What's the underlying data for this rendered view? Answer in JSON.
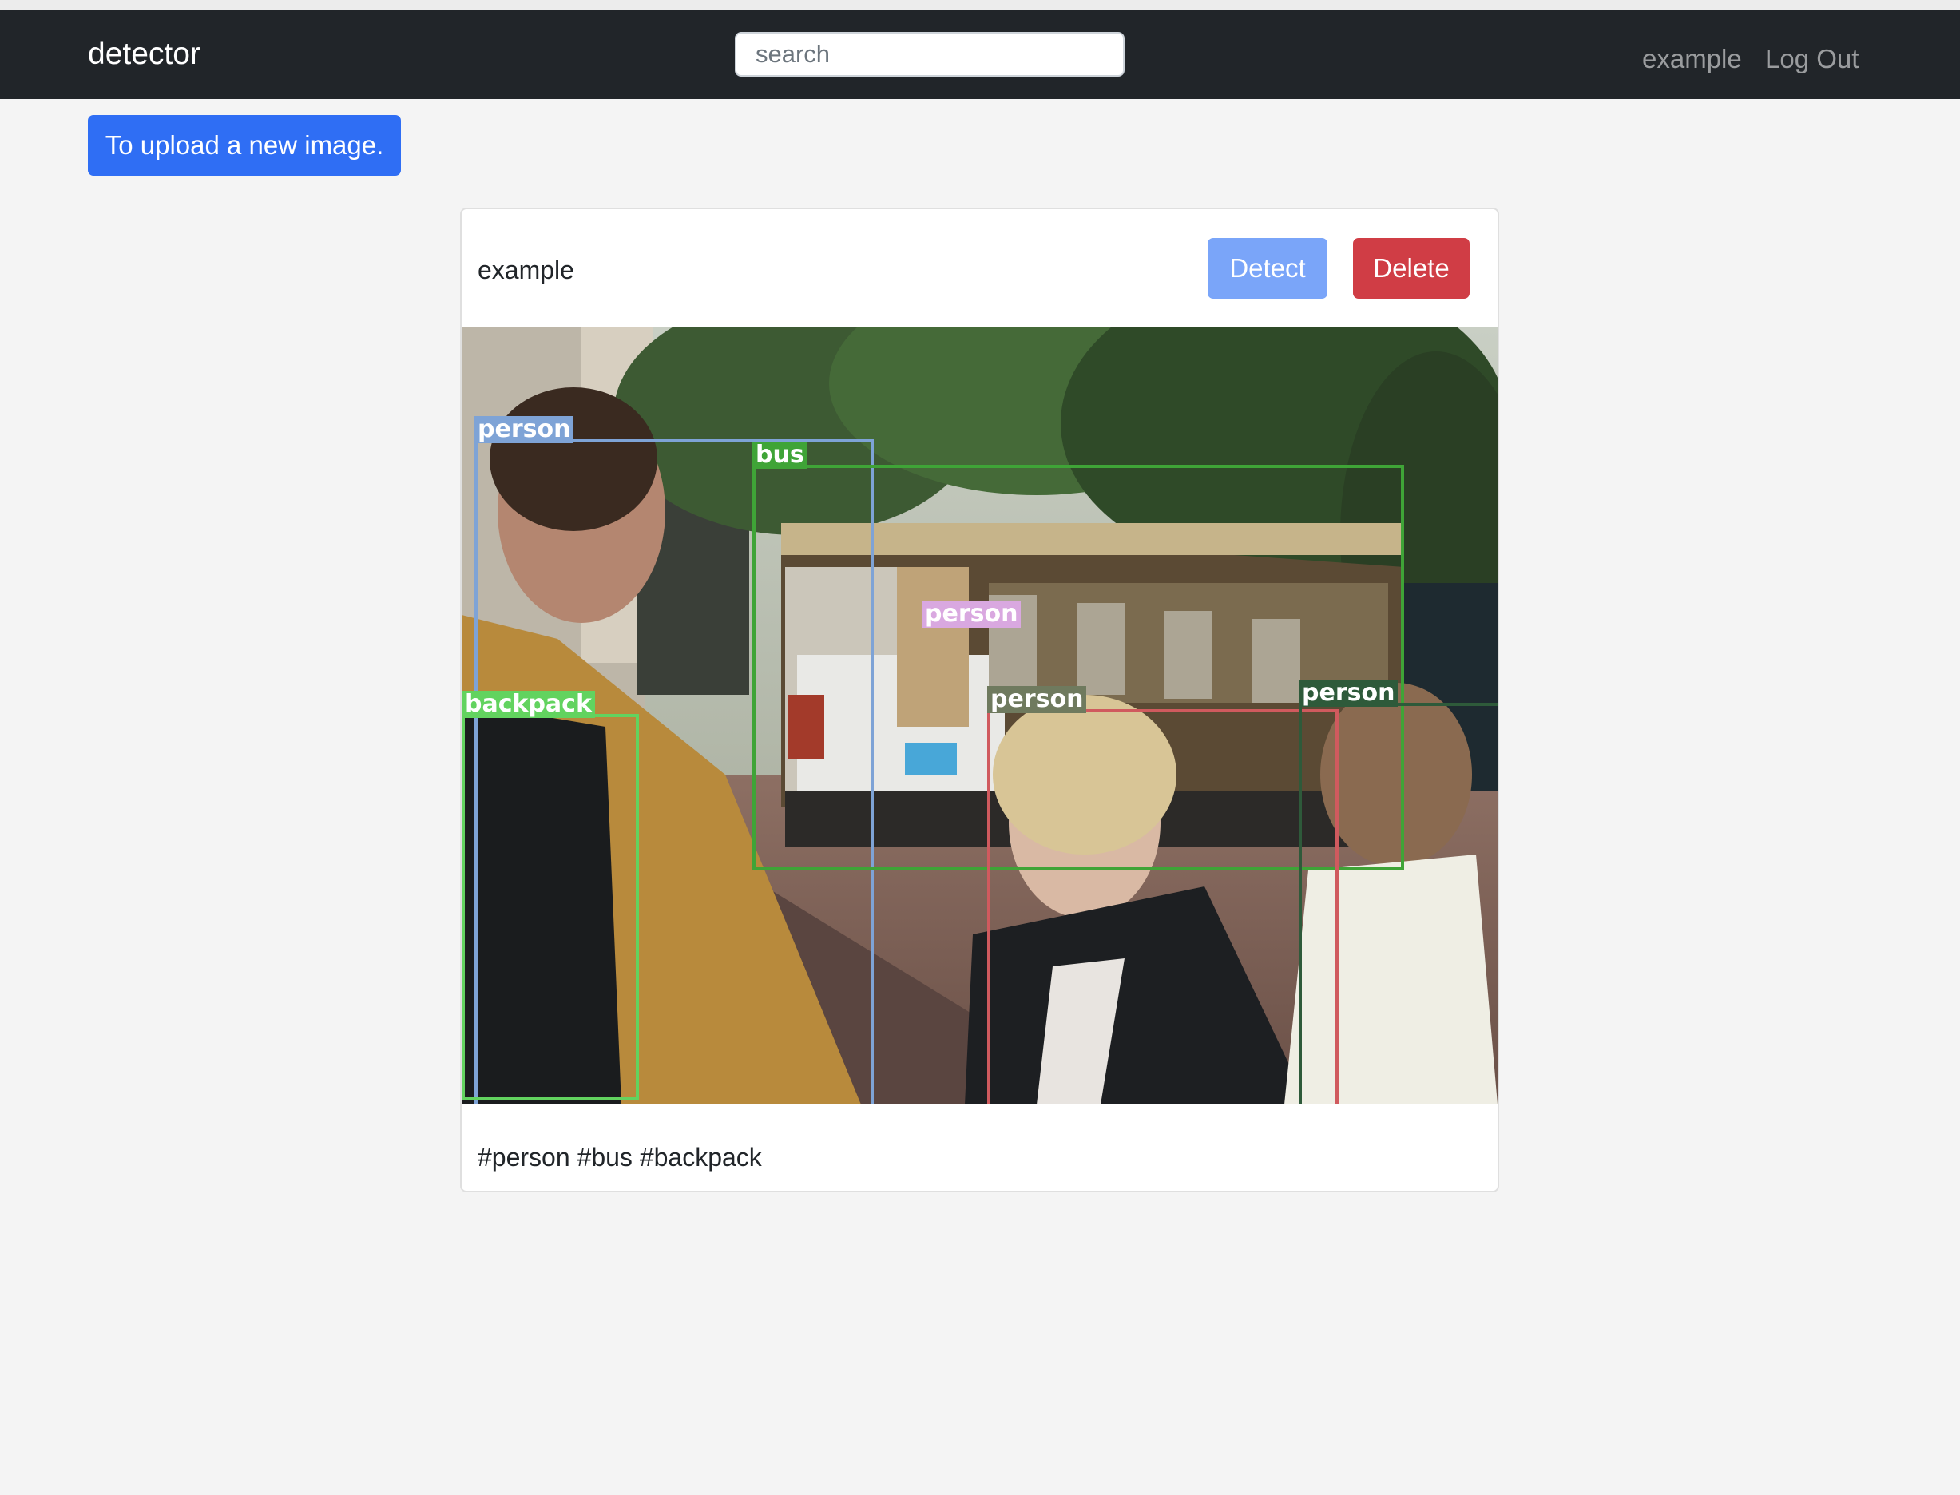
{
  "navbar": {
    "brand": "detector",
    "search_placeholder": "search",
    "user_link": "example",
    "logout_link": "Log Out"
  },
  "upload_button": "To upload a new image.",
  "card": {
    "title": "example",
    "detect_label": "Detect",
    "delete_label": "Delete",
    "tags": "#person #bus #backpack",
    "detections": [
      {
        "label": "person",
        "color": "#7ea3d6"
      },
      {
        "label": "bus",
        "color": "#3fa437"
      },
      {
        "label": "person",
        "color": "#d9a8e0"
      },
      {
        "label": "backpack",
        "color": "#62d35f"
      },
      {
        "label": "person",
        "color": "#6f7a5e"
      },
      {
        "label": "person",
        "color": "#2e5a3a"
      }
    ]
  }
}
